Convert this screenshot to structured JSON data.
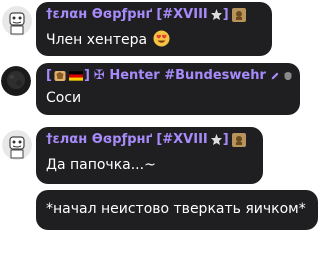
{
  "messages": [
    {
      "sender": {
        "name": "†ɛлαн Ѳɞрƒрнґ",
        "tag": "[#XVIII",
        "tag_close": "]",
        "color": "#a78bfa"
      },
      "text": "Член хентера",
      "emoji": "smiling-face-with-heart-eyes"
    },
    {
      "sender": {
        "tag_open": "[",
        "tag_close": "]",
        "name": "✠ Henter #Bundeswehr",
        "color": "#a78bfa"
      },
      "text": "Соси"
    },
    {
      "sender": {
        "name": "†ɛлαн Ѳɞрƒрнґ",
        "tag": "[#XVIII",
        "tag_close": "]",
        "color": "#a78bfa"
      },
      "text": "Да папочка...~"
    },
    {
      "text": "*начал неистово тверкать яичком*"
    }
  ]
}
